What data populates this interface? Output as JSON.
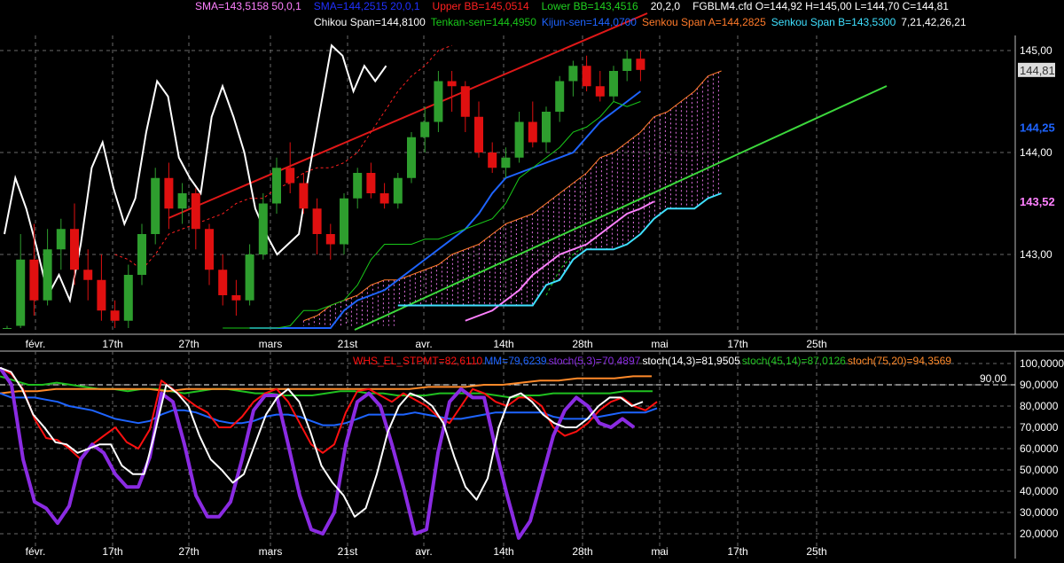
{
  "colors": {
    "background": "#000000",
    "grid": "#6a6a6a",
    "text": "#ffffff",
    "up_candle": "#2e9e2e",
    "down_candle": "#e01010",
    "chikou": "#ffffff",
    "tenkan": "#19c819",
    "kijun": "#1e64ff",
    "senkou_a": "#ff7a2a",
    "senkou_b": "#3fe0ff",
    "kumo_fill": "#e070e0",
    "trendline_red": "#e01818",
    "trendline_green": "#3cd83c",
    "sma50": "#ff80ff",
    "sma20": "#2030ff",
    "upper_bb": "#ff2020",
    "lower_bb": "#20d020",
    "whs": "#ff1010",
    "mm": "#1e64ff",
    "stoch_5_3": "#8a2be2",
    "stoch_14_3": "#ffffff",
    "stoch_45_14": "#20c020",
    "stoch_75_20": "#ff8a2a",
    "level_line": "#ffffff"
  },
  "header": {
    "line1": [
      {
        "text": "SMA=143,5158  50,0,1",
        "color": "#ff80ff"
      },
      {
        "text": "SMA=144,2515  20,0,1",
        "color": "#2030ff"
      },
      {
        "text": "Upper BB=145,0514",
        "color": "#ff2020"
      },
      {
        "text": "Lower BB=143,4516",
        "color": "#20d020"
      },
      {
        "text": "20,2,0",
        "color": "#ffffff"
      },
      {
        "text": "FGBLM4.cfd O=144,92 H=145,00 L=144,70 C=144,81",
        "color": "#ffffff"
      }
    ],
    "line2": [
      {
        "text": "Chikou Span=144,8100",
        "color": "#ffffff"
      },
      {
        "text": "Tenkan-sen=144,4950",
        "color": "#19c819"
      },
      {
        "text": "Kijun-sen=144,0700",
        "color": "#1e64ff"
      },
      {
        "text": "Senkou Span A=144,2825",
        "color": "#ff7a2a"
      },
      {
        "text": "Senkou Span B=143,5300",
        "color": "#3fe0ff"
      },
      {
        "text": "7,21,42,26,21",
        "color": "#ffffff"
      }
    ]
  },
  "lower_header": [
    {
      "text": "WHS_EL_STPMT=82,6110",
      "color": "#ff1010"
    },
    {
      "text": "MM=79,6239",
      "color": "#1e64ff"
    },
    {
      "text": "stoch(5,3)=70,4897",
      "color": "#8a2be2"
    },
    {
      "text": "stoch(14,3)=81,9505",
      "color": "#ffffff"
    },
    {
      "text": "stoch(45,14)=87,0126",
      "color": "#20c020"
    },
    {
      "text": "stoch(75,20)=94,3569",
      "color": "#ff8a2a"
    }
  ],
  "date_ticks": [
    "févr.",
    "17th",
    "27th",
    "mars",
    "21st",
    "avr.",
    "14th",
    "28th",
    "mai",
    "17th",
    "25th"
  ],
  "chart_data": [
    {
      "type": "candlestick",
      "title": "FGBLM4.cfd",
      "y_ticks": [
        "145,00",
        "144,00",
        "143,00"
      ],
      "y_tick_values": [
        145.0,
        144.0,
        143.0
      ],
      "ylim": [
        142.25,
        145.4
      ],
      "price_badges": [
        {
          "text": "144,81",
          "value": 144.81,
          "color": "#ffffff",
          "style": "box"
        },
        {
          "text": "144,25",
          "value": 144.25,
          "color": "#1e64ff",
          "style": "plain"
        },
        {
          "text": "143,52",
          "value": 143.52,
          "color": "#ff80ff",
          "style": "plain"
        }
      ],
      "candles": [
        [
          142.05,
          142.3,
          141.9,
          142.25
        ],
        [
          142.3,
          143.2,
          142.1,
          142.95
        ],
        [
          142.95,
          143.3,
          142.4,
          142.55
        ],
        [
          142.55,
          143.25,
          142.5,
          143.05
        ],
        [
          143.05,
          143.35,
          142.85,
          143.25
        ],
        [
          143.25,
          143.5,
          142.7,
          142.85
        ],
        [
          142.85,
          143.05,
          142.55,
          142.75
        ],
        [
          142.75,
          143.0,
          142.35,
          142.45
        ],
        [
          142.45,
          142.55,
          142.15,
          142.35
        ],
        [
          142.35,
          142.9,
          142.25,
          142.8
        ],
        [
          142.8,
          143.3,
          142.7,
          143.2
        ],
        [
          143.2,
          143.85,
          143.1,
          143.75
        ],
        [
          143.75,
          143.9,
          143.25,
          143.45
        ],
        [
          143.45,
          143.7,
          143.3,
          143.6
        ],
        [
          143.6,
          143.65,
          143.05,
          143.25
        ],
        [
          143.25,
          143.3,
          142.7,
          142.85
        ],
        [
          142.85,
          143.0,
          142.5,
          142.6
        ],
        [
          142.6,
          142.75,
          142.4,
          142.55
        ],
        [
          142.55,
          143.1,
          142.5,
          143.0
        ],
        [
          143.0,
          143.6,
          142.95,
          143.5
        ],
        [
          143.5,
          143.95,
          143.4,
          143.85
        ],
        [
          143.85,
          144.1,
          143.6,
          143.7
        ],
        [
          143.7,
          143.8,
          143.4,
          143.45
        ],
        [
          143.45,
          143.55,
          143.0,
          143.2
        ],
        [
          143.2,
          143.3,
          142.95,
          143.1
        ],
        [
          143.1,
          143.6,
          143.0,
          143.55
        ],
        [
          143.55,
          143.85,
          143.45,
          143.8
        ],
        [
          143.8,
          143.9,
          143.55,
          143.6
        ],
        [
          143.6,
          143.7,
          143.45,
          143.5
        ],
        [
          143.5,
          143.8,
          143.45,
          143.75
        ],
        [
          143.75,
          144.2,
          143.7,
          144.15
        ],
        [
          144.15,
          144.45,
          144.0,
          144.3
        ],
        [
          144.3,
          144.8,
          144.2,
          144.7
        ],
        [
          144.7,
          144.8,
          144.4,
          144.65
        ],
        [
          144.65,
          144.7,
          144.2,
          144.35
        ],
        [
          144.35,
          144.5,
          143.95,
          144.0
        ],
        [
          144.0,
          144.1,
          143.8,
          143.85
        ],
        [
          143.85,
          144.05,
          143.75,
          143.95
        ],
        [
          143.95,
          144.4,
          143.9,
          144.3
        ],
        [
          144.3,
          144.5,
          144.05,
          144.1
        ],
        [
          144.1,
          144.45,
          144.0,
          144.4
        ],
        [
          144.4,
          144.75,
          144.3,
          144.7
        ],
        [
          144.7,
          144.9,
          144.55,
          144.85
        ],
        [
          144.85,
          144.95,
          144.6,
          144.65
        ],
        [
          144.65,
          144.8,
          144.5,
          144.55
        ],
        [
          144.55,
          144.85,
          144.5,
          144.8
        ],
        [
          144.8,
          145.0,
          144.7,
          144.92
        ],
        [
          144.92,
          145.0,
          144.7,
          144.81
        ]
      ],
      "chikou_span": [
        143.2,
        143.75,
        143.45,
        143.05,
        142.6,
        142.8,
        142.55,
        143.1,
        143.85,
        144.1,
        143.65,
        143.3,
        143.55,
        144.2,
        144.7,
        144.55,
        143.95,
        143.75,
        143.6,
        144.35,
        144.65,
        144.35,
        144.0,
        143.45,
        143.2,
        143.0,
        143.1,
        143.2,
        143.85,
        144.45,
        145.05,
        144.95,
        144.6,
        144.85,
        144.7,
        144.85
      ],
      "tenkan_sen": [
        142.0,
        142.0,
        142.05,
        142.1,
        142.2,
        142.3,
        142.45,
        142.45,
        142.5,
        142.55,
        142.7,
        142.95,
        143.1,
        143.1,
        143.1,
        143.15,
        143.15,
        143.2,
        143.25,
        143.3,
        143.35,
        143.5,
        143.75,
        143.85,
        143.95,
        144.05,
        144.2,
        144.25,
        144.35,
        144.5,
        144.45,
        144.5
      ],
      "kijun_sen": [
        142.05,
        142.05,
        142.05,
        142.05,
        142.05,
        142.1,
        142.2,
        142.45,
        142.55,
        142.6,
        142.65,
        142.75,
        142.85,
        142.95,
        143.05,
        143.15,
        143.25,
        143.4,
        143.6,
        143.75,
        143.8,
        143.85,
        143.9,
        143.95,
        144.0,
        144.15,
        144.3,
        144.4,
        144.5,
        144.6
      ],
      "senkou_span_a": [
        142.35,
        142.4,
        142.5,
        142.55,
        142.6,
        142.7,
        142.75,
        142.75,
        142.8,
        142.85,
        142.9,
        143.0,
        143.05,
        143.1,
        143.2,
        143.3,
        143.35,
        143.4,
        143.5,
        143.6,
        143.7,
        143.8,
        143.95,
        144.0,
        144.1,
        144.2,
        144.35,
        144.4,
        144.5,
        144.6,
        144.75,
        144.8
      ],
      "senkou_span_b": [
        142.5,
        142.5,
        142.5,
        142.5,
        142.5,
        142.5,
        142.5,
        142.5,
        142.5,
        142.5,
        142.5,
        142.7,
        142.75,
        142.95,
        143.05,
        143.05,
        143.05,
        143.1,
        143.2,
        143.35,
        143.45,
        143.45,
        143.45,
        143.55,
        143.6
      ],
      "sma_50": [
        142.35,
        142.4,
        142.45,
        142.55,
        142.65,
        142.8,
        142.9,
        143.0,
        143.05,
        143.1,
        143.2,
        143.3,
        143.4,
        143.45,
        143.52
      ],
      "upper_bb": [
        143.0,
        142.95,
        142.85,
        143.0,
        143.2,
        143.25,
        143.3,
        143.35,
        143.4,
        143.5,
        143.55,
        143.55,
        143.65,
        143.7,
        143.8,
        143.85,
        143.85,
        143.9,
        144.0,
        144.2,
        144.4,
        144.6,
        144.75,
        144.85,
        145.0,
        145.05
      ],
      "lower_bb": [
        142.6,
        142.85,
        143.0,
        143.1,
        143.2,
        143.3,
        143.4,
        143.45
      ]
    },
    {
      "type": "line",
      "title": "stochastics",
      "y_ticks": [
        "100,0000",
        "90,0000",
        "80,0000",
        "70,0000",
        "60,0000",
        "50,0000",
        "40,0000",
        "30,0000",
        "20,0000"
      ],
      "y_tick_values": [
        100,
        90,
        80,
        70,
        60,
        50,
        40,
        30,
        20
      ],
      "ylim": [
        10,
        104
      ],
      "level": {
        "value": 90,
        "label": "90,00"
      },
      "series": [
        {
          "name": "WHS_EL_STPMT",
          "values": [
            98,
            95,
            88,
            74,
            65,
            64,
            60,
            55,
            62,
            66,
            70,
            63,
            60,
            69,
            92,
            88,
            84,
            80,
            77,
            70,
            70,
            75,
            82,
            86,
            88,
            82,
            72,
            62,
            58,
            62,
            77,
            87,
            88,
            85,
            82,
            86,
            83,
            80,
            75,
            72,
            80,
            88,
            86,
            82,
            80,
            84,
            84,
            80,
            70,
            66,
            68,
            72,
            78,
            82,
            84,
            80,
            78,
            82
          ]
        },
        {
          "name": "MM",
          "values": [
            86,
            84,
            84,
            84,
            83,
            82,
            80,
            79,
            78,
            76,
            74,
            73,
            72,
            73,
            76,
            78,
            78,
            77,
            75,
            73,
            72,
            72,
            73,
            75,
            76,
            76,
            75,
            73,
            71,
            71,
            72,
            74,
            76,
            76,
            76,
            76,
            77,
            76,
            75,
            74,
            74,
            75,
            76,
            77,
            77,
            77,
            77,
            77,
            75,
            74,
            74,
            74,
            75,
            76,
            77,
            77,
            77,
            79
          ]
        },
        {
          "name": "stoch(5,3)",
          "values": [
            98,
            90,
            55,
            35,
            32,
            25,
            33,
            55,
            62,
            58,
            48,
            42,
            42,
            56,
            86,
            82,
            62,
            38,
            28,
            28,
            35,
            55,
            78,
            85,
            85,
            62,
            38,
            22,
            20,
            30,
            62,
            82,
            86,
            80,
            62,
            42,
            20,
            22,
            58,
            82,
            88,
            84,
            84,
            60,
            38,
            18,
            26,
            46,
            66,
            78,
            84,
            80,
            72,
            70,
            74,
            70
          ]
        },
        {
          "name": "stoch(14,3)",
          "values": [
            98,
            96,
            88,
            76,
            70,
            63,
            62,
            58,
            60,
            62,
            62,
            52,
            48,
            48,
            68,
            90,
            86,
            80,
            66,
            55,
            50,
            44,
            48,
            62,
            76,
            84,
            88,
            82,
            68,
            52,
            44,
            38,
            28,
            32,
            48,
            68,
            80,
            86,
            84,
            80,
            72,
            56,
            42,
            36,
            46,
            70,
            84,
            86,
            82,
            76,
            72,
            70,
            70,
            74,
            80,
            84,
            84,
            80,
            82
          ]
        },
        {
          "name": "stoch(45,14)",
          "values": [
            94,
            92,
            90,
            90,
            91,
            90,
            89,
            88,
            88,
            87,
            88,
            88,
            87,
            86,
            87,
            88,
            88,
            87,
            86,
            86,
            85,
            85,
            85,
            86,
            87,
            87,
            86,
            86,
            85,
            85,
            85,
            86,
            86,
            86,
            86,
            85,
            84,
            85,
            85,
            86,
            86,
            86,
            86,
            86,
            87,
            87,
            87
          ]
        },
        {
          "name": "stoch(75,20)",
          "values": [
            86,
            87,
            87,
            88,
            88,
            88,
            88,
            88,
            88,
            87,
            88,
            88,
            88,
            88,
            88,
            88,
            88,
            88,
            88,
            88,
            88,
            88,
            88,
            89,
            89,
            89,
            90,
            90,
            91,
            92,
            92,
            93,
            93,
            93,
            94,
            94
          ]
        }
      ]
    }
  ]
}
